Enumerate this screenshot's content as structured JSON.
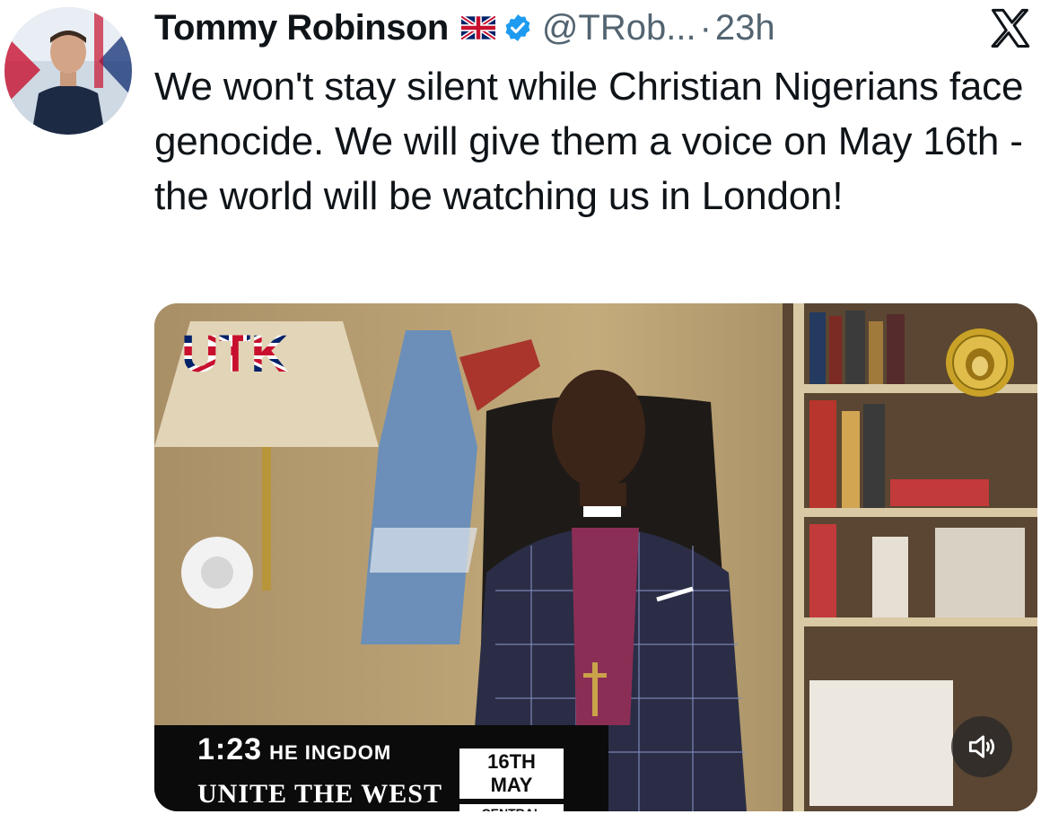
{
  "author": {
    "name": "Tommy Robinson",
    "handle": "@TRob...",
    "separator": "·",
    "timestamp": "23h"
  },
  "tweet": {
    "text": "We won't stay silent while Christian Nigerians face genocide. We will give them a voice on May 16th - the world will be watching us in London!"
  },
  "video": {
    "duration": "1:23",
    "overlay_logo": "UTK",
    "banner_kingdom": "HE INGDOM",
    "banner_main": "UNITE THE WEST",
    "date_main": "16TH MAY",
    "date_sub": "CENTRAL LONDON"
  },
  "icons": {
    "flag": "uk-flag-icon",
    "verified": "verified-badge-icon",
    "platform": "x-logo-icon",
    "volume": "speaker-icon"
  },
  "colors": {
    "text_primary": "#0f1419",
    "text_secondary": "#536471",
    "verified_blue": "#1d9bf0"
  }
}
